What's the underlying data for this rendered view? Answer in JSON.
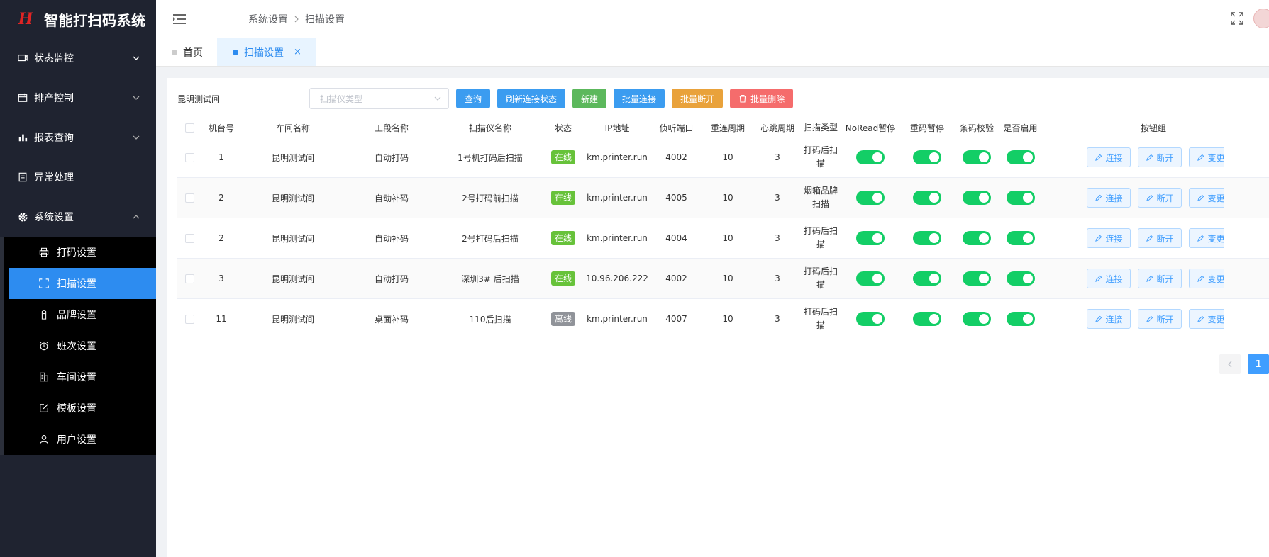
{
  "app": {
    "title": "智能打扫码系统",
    "logo_mark": "H"
  },
  "sidebar": {
    "menus": [
      {
        "label": "状态监控",
        "icon": "monitor-icon",
        "expandable": true,
        "open": false
      },
      {
        "label": "排产控制",
        "icon": "calendar-icon",
        "expandable": true,
        "open": false
      },
      {
        "label": "报表查询",
        "icon": "bar-chart-icon",
        "expandable": true,
        "open": false
      },
      {
        "label": "异常处理",
        "icon": "document-icon",
        "expandable": false
      },
      {
        "label": "系统设置",
        "icon": "gear-icon",
        "expandable": true,
        "open": true
      }
    ],
    "submenu": [
      {
        "label": "打码设置",
        "icon": "printer-icon",
        "active": false
      },
      {
        "label": "扫描设置",
        "icon": "scan-icon",
        "active": true
      },
      {
        "label": "品牌设置",
        "icon": "tag-icon",
        "active": false
      },
      {
        "label": "班次设置",
        "icon": "alarm-clock-icon",
        "active": false
      },
      {
        "label": "车间设置",
        "icon": "building-icon",
        "active": false
      },
      {
        "label": "模板设置",
        "icon": "edit-icon",
        "active": false
      },
      {
        "label": "用户设置",
        "icon": "user-icon",
        "active": false
      }
    ]
  },
  "header": {
    "breadcrumb": [
      "系统设置",
      "扫描设置"
    ]
  },
  "tabs": [
    {
      "label": "首页",
      "active": false
    },
    {
      "label": "扫描设置",
      "active": true,
      "close": "×"
    }
  ],
  "toolbar": {
    "workshop_label": "昆明测试间",
    "scanner_type_placeholder": "扫描仪类型",
    "buttons": {
      "query": "查询",
      "refresh": "刷新连接状态",
      "create": "新建",
      "batch_connect": "批量连接",
      "batch_disconnect": "批量断开",
      "batch_delete": "批量删除"
    }
  },
  "table": {
    "headers": {
      "machine_no": "机台号",
      "workshop": "车间名称",
      "section": "工段名称",
      "scanner": "扫描仪名称",
      "status": "状态",
      "ip": "IP地址",
      "port": "侦听端口",
      "reconnect": "重连周期",
      "heartbeat": "心跳周期",
      "scan_type": "扫描类型",
      "noread": "NoRead暂停",
      "dup": "重码暂停",
      "barcode": "条码校验",
      "enabled": "是否启用",
      "ops": "按钮组"
    },
    "ops_labels": {
      "connect": "连接",
      "disconnect": "断开",
      "change": "变更"
    },
    "rows": [
      {
        "machine_no": "1",
        "workshop": "昆明测试间",
        "section": "自动打码",
        "scanner": "1号机打码后扫描",
        "status": "在线",
        "online": true,
        "ip": "km.printer.run",
        "port": "4002",
        "reconnect": "10",
        "heartbeat": "3",
        "scan_type": "打码后扫描"
      },
      {
        "machine_no": "2",
        "workshop": "昆明测试间",
        "section": "自动补码",
        "scanner": "2号打码前扫描",
        "status": "在线",
        "online": true,
        "ip": "km.printer.run",
        "port": "4005",
        "reconnect": "10",
        "heartbeat": "3",
        "scan_type": "烟箱品牌扫描"
      },
      {
        "machine_no": "2",
        "workshop": "昆明测试间",
        "section": "自动补码",
        "scanner": "2号打码后扫描",
        "status": "在线",
        "online": true,
        "ip": "km.printer.run",
        "port": "4004",
        "reconnect": "10",
        "heartbeat": "3",
        "scan_type": "打码后扫描"
      },
      {
        "machine_no": "3",
        "workshop": "昆明测试间",
        "section": "自动打码",
        "scanner": "深圳3# 后扫描",
        "status": "在线",
        "online": true,
        "ip": "10.96.206.222",
        "port": "4002",
        "reconnect": "10",
        "heartbeat": "3",
        "scan_type": "打码后扫描"
      },
      {
        "machine_no": "11",
        "workshop": "昆明测试间",
        "section": "桌面补码",
        "scanner": "110后扫描",
        "status": "离线",
        "online": false,
        "ip": "km.printer.run",
        "port": "4007",
        "reconnect": "10",
        "heartbeat": "3",
        "scan_type": "打码后扫描"
      }
    ]
  },
  "pagination": {
    "current": "1"
  },
  "colors": {
    "sidebar_bg": "#1f2330",
    "active_blue": "#2d8cf0",
    "switch_on": "#13ce66",
    "online": "#67c23a",
    "offline": "#909399"
  }
}
